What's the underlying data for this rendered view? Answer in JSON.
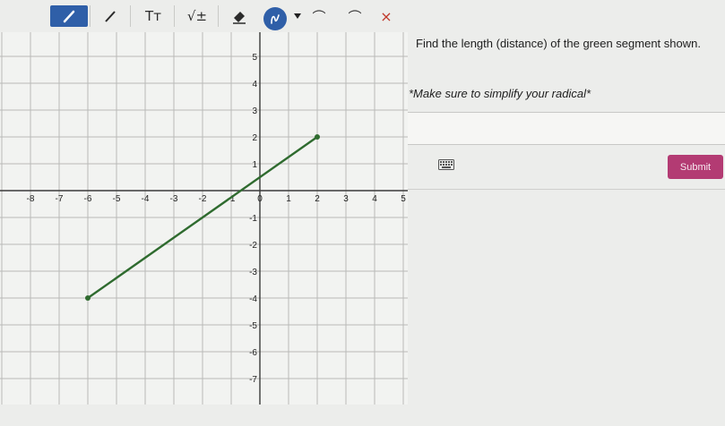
{
  "toolbar": {
    "tools": [
      {
        "name": "pencil-icon",
        "glyph": "",
        "active": true
      },
      {
        "name": "line-tool-icon",
        "glyph": ""
      },
      {
        "name": "text-tool-icon",
        "glyph": "Tт"
      },
      {
        "name": "equation-tool-icon",
        "glyph": "√±"
      },
      {
        "name": "eraser-icon",
        "glyph": ""
      }
    ],
    "undo_glyph": "⌒",
    "redo_glyph": "⌒",
    "close_glyph": "×"
  },
  "graph": {
    "x_range": [
      -8,
      5
    ],
    "y_range": [
      -7,
      5
    ],
    "x_tick_labels": [
      "-8",
      "-7",
      "-6",
      "-5",
      "-4",
      "-3",
      "-2",
      "-1",
      "0",
      "1",
      "2",
      "3",
      "4",
      "5"
    ],
    "y_tick_labels": [
      "5",
      "4",
      "3",
      "2",
      "1",
      "-1",
      "-2",
      "-3",
      "-4",
      "-5",
      "-6",
      "-7"
    ],
    "segment": {
      "start": [
        -6,
        -4
      ],
      "end": [
        2,
        2
      ],
      "color": "#2f6b2f"
    }
  },
  "question": {
    "text": "Find the length (distance) of the green segment shown.",
    "note": "*Make sure to simplify your radical*"
  },
  "answer": {
    "value": ""
  },
  "submit_label": "Submit",
  "colors": {
    "accent": "#2f5fa8",
    "submit": "#b33b73",
    "segment": "#2f6b2f"
  }
}
